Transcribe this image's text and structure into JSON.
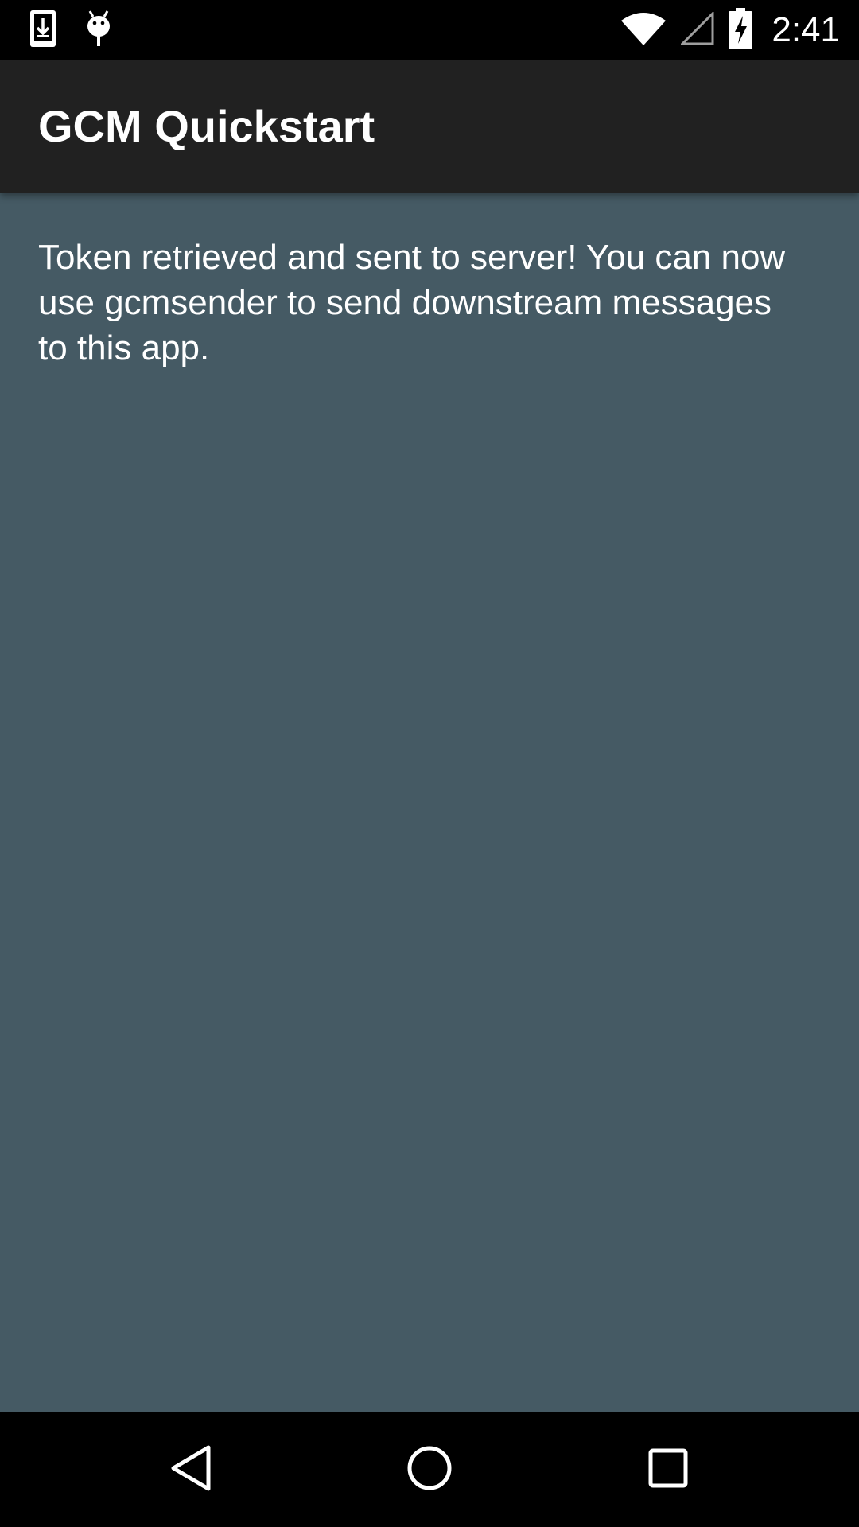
{
  "status_bar": {
    "time": "2:41",
    "left_icons": [
      "download-icon",
      "android-debug-icon"
    ],
    "right_icons": [
      "wifi-icon",
      "cell-signal-icon",
      "battery-charging-icon"
    ]
  },
  "toolbar": {
    "title": "GCM Quickstart"
  },
  "main": {
    "message": "Token retrieved and sent to server! You can now use gcmsender to send downstream messages to this app."
  },
  "nav_bar": {
    "buttons": [
      "back-icon",
      "home-icon",
      "recents-icon"
    ]
  },
  "colors": {
    "status_bar": "#000000",
    "toolbar": "#212121",
    "content_background": "#455a64",
    "text": "#ffffff",
    "nav_bar": "#000000"
  }
}
